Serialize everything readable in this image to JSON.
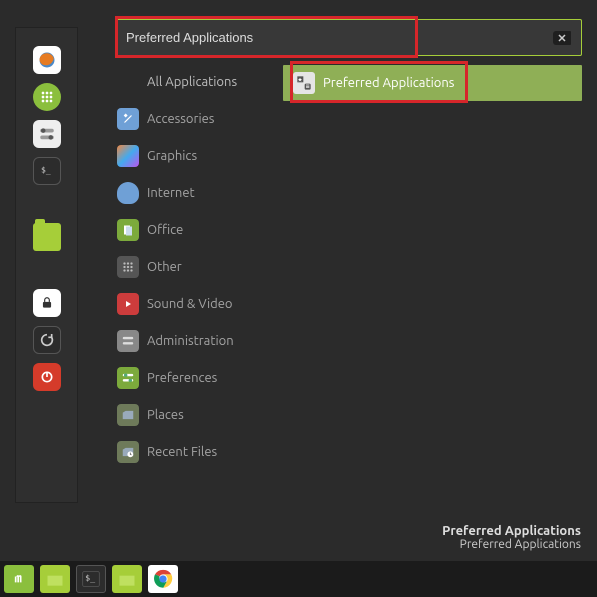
{
  "search": {
    "value": "Preferred Applications",
    "placeholder": ""
  },
  "categories": [
    {
      "id": "all",
      "label": "All Applications",
      "icon": "all"
    },
    {
      "id": "acc",
      "label": "Accessories",
      "icon": "acc"
    },
    {
      "id": "gfx",
      "label": "Graphics",
      "icon": "gfx"
    },
    {
      "id": "net",
      "label": "Internet",
      "icon": "net"
    },
    {
      "id": "office",
      "label": "Office",
      "icon": "office"
    },
    {
      "id": "other",
      "label": "Other",
      "icon": "other"
    },
    {
      "id": "snd",
      "label": "Sound & Video",
      "icon": "snd"
    },
    {
      "id": "admin",
      "label": "Administration",
      "icon": "admin"
    },
    {
      "id": "pref",
      "label": "Preferences",
      "icon": "pref"
    },
    {
      "id": "places",
      "label": "Places",
      "icon": "places"
    },
    {
      "id": "recent",
      "label": "Recent Files",
      "icon": "recent"
    }
  ],
  "results": [
    {
      "label": "Preferred Applications"
    }
  ],
  "footer": {
    "title": "Preferred Applications",
    "subtitle": "Preferred Applications"
  },
  "launcher": [
    {
      "name": "firefox-icon"
    },
    {
      "name": "apps-icon"
    },
    {
      "name": "toggles-icon"
    },
    {
      "name": "terminal-icon"
    },
    {
      "name": "files-icon"
    },
    {
      "name": "lock-icon"
    },
    {
      "name": "reload-icon"
    },
    {
      "name": "power-icon"
    }
  ],
  "taskbar": [
    {
      "name": "mint-menu-icon"
    },
    {
      "name": "files-icon"
    },
    {
      "name": "terminal-icon"
    },
    {
      "name": "files-open-icon"
    },
    {
      "name": "chrome-icon"
    }
  ]
}
